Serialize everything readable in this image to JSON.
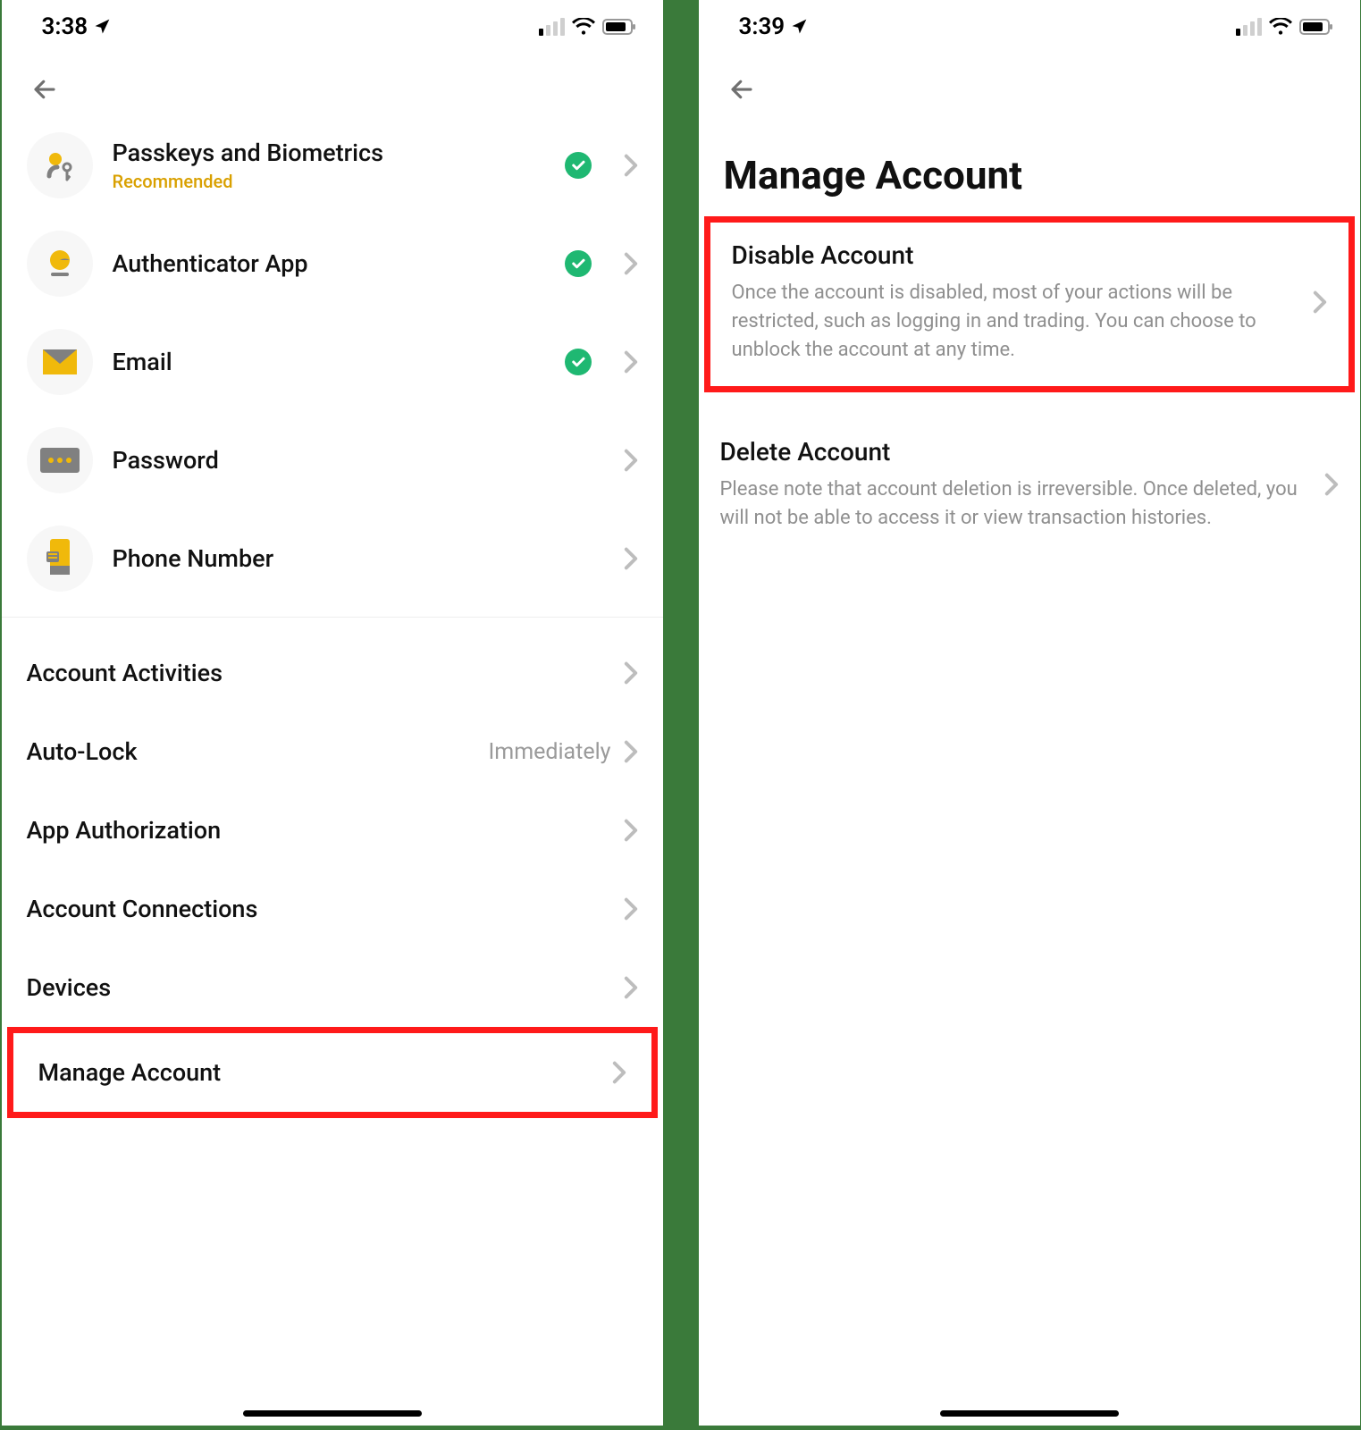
{
  "left": {
    "status_time": "3:38",
    "back_name": "back",
    "security": [
      {
        "key": "passkeys",
        "label": "Passkeys and Biometrics",
        "sub": "Recommended",
        "checked": true
      },
      {
        "key": "authapp",
        "label": "Authenticator App",
        "checked": true
      },
      {
        "key": "email",
        "label": "Email",
        "checked": true
      },
      {
        "key": "password",
        "label": "Password",
        "checked": false
      },
      {
        "key": "phone",
        "label": "Phone Number",
        "checked": false
      }
    ],
    "settings": [
      {
        "key": "activities",
        "label": "Account Activities"
      },
      {
        "key": "autolock",
        "label": "Auto-Lock",
        "value": "Immediately"
      },
      {
        "key": "appauth",
        "label": "App Authorization"
      },
      {
        "key": "connections",
        "label": "Account Connections"
      },
      {
        "key": "devices",
        "label": "Devices"
      },
      {
        "key": "manage",
        "label": "Manage Account",
        "highlight": true
      }
    ]
  },
  "right": {
    "status_time": "3:39",
    "title": "Manage Account",
    "options": [
      {
        "key": "disable",
        "title": "Disable Account",
        "desc": "Once the account is disabled, most of your actions will be restricted, such as logging in and trading. You can choose to unblock the account at any time.",
        "highlight": true
      },
      {
        "key": "delete",
        "title": "Delete Account",
        "desc": "Please note that account deletion is irreversible. Once deleted, you will not be able to access it or view transaction histories."
      }
    ]
  }
}
